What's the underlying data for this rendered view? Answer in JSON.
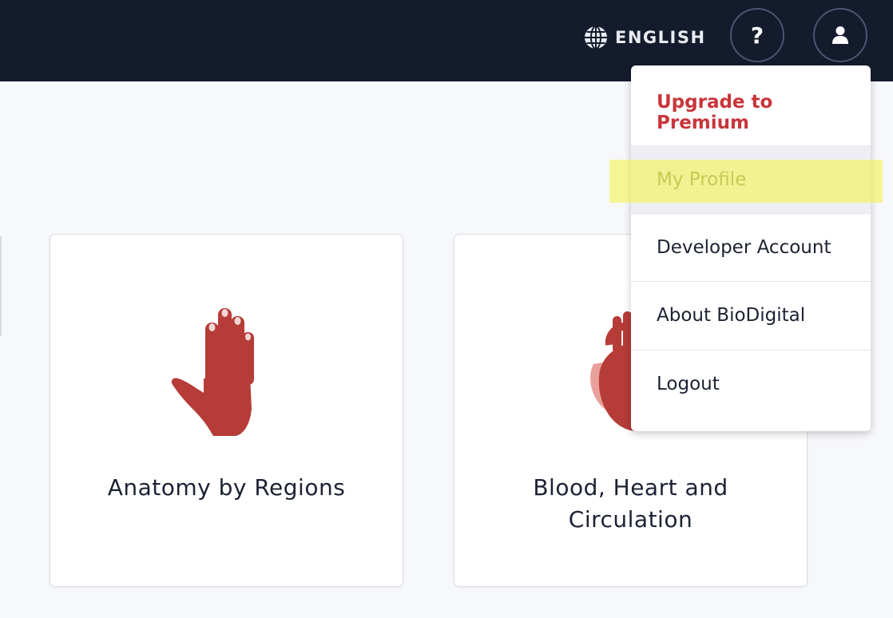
{
  "header": {
    "language_label": "ENGLISH",
    "help_label": "?",
    "icons": {
      "language": "globe-icon",
      "help": "question-icon",
      "user": "user-icon"
    }
  },
  "cards": [
    {
      "title": "Anatomy by Regions",
      "icon": "hand-icon"
    },
    {
      "title_line1": "Blood, Heart and",
      "title_line2": "Circulation",
      "icon": "heart-icon"
    }
  ],
  "user_menu": {
    "items": [
      {
        "label": "Upgrade to Premium"
      },
      {
        "label": "My Profile"
      },
      {
        "label": "Developer Account"
      },
      {
        "label": "About BioDigital"
      },
      {
        "label": "Logout"
      }
    ]
  },
  "colors": {
    "header_bg": "#141b2d",
    "accent_red": "#c8353a",
    "anatomy_red": "#b63c38",
    "highlight": "#f3f350"
  }
}
